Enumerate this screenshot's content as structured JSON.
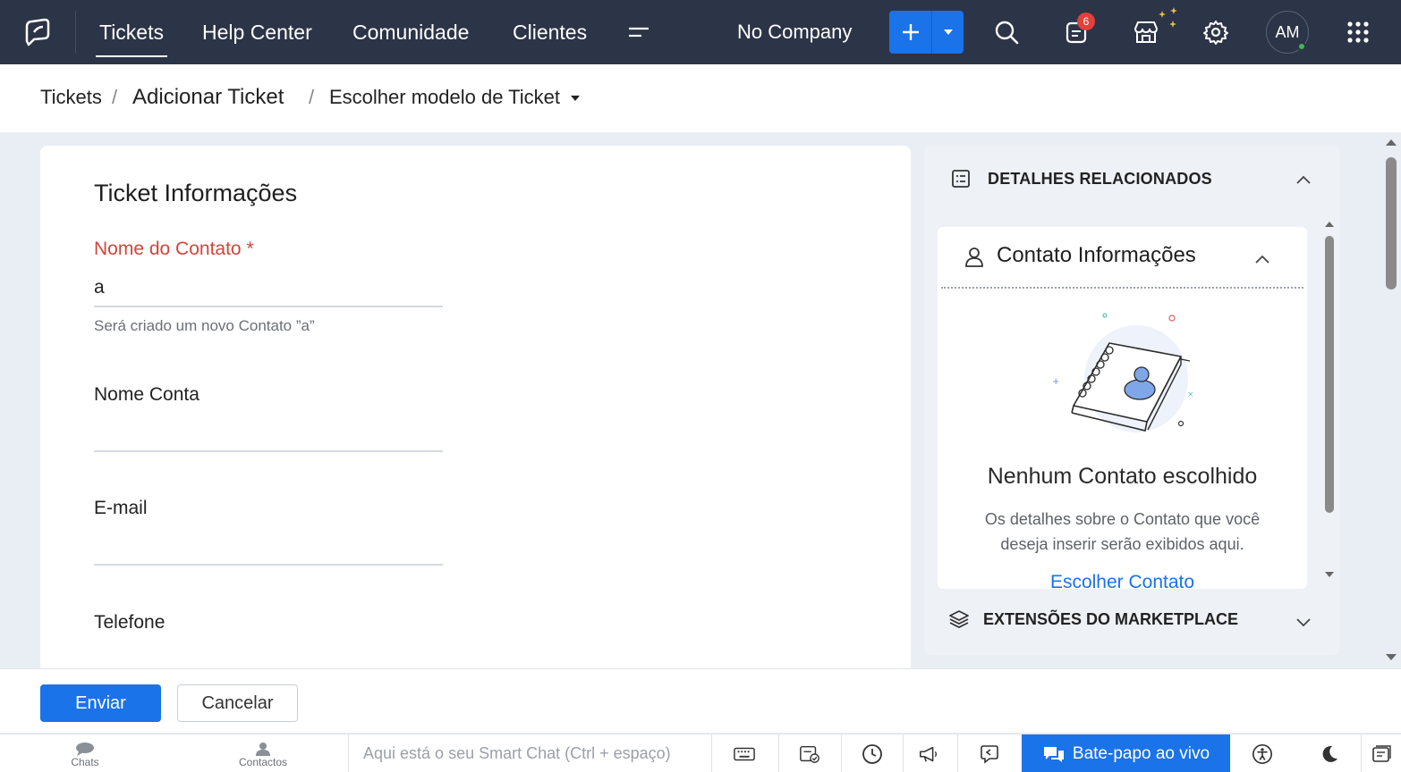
{
  "nav": {
    "items": [
      {
        "label": "Tickets"
      },
      {
        "label": "Help Center"
      },
      {
        "label": "Comunidade"
      },
      {
        "label": "Clientes"
      }
    ],
    "company": "No Company",
    "notification_count": "6",
    "avatar_initials": "AM"
  },
  "breadcrumb": {
    "root": "Tickets",
    "sep": "/",
    "current": "Adicionar Ticket",
    "template": "Escolher modelo de Ticket"
  },
  "form": {
    "title": "Ticket Informações",
    "contact_label": "Nome do Contato",
    "required_mark": "*",
    "contact_value": "a",
    "contact_hint": "Será criado um novo Contato ”a”",
    "account_label": "Nome Conta",
    "email_label": "E-mail",
    "phone_label": "Telefone"
  },
  "related": {
    "title": "DETALHES RELACIONADOS",
    "contact_section_title": "Contato Informações",
    "empty_title": "Nenhum Contato escolhido",
    "empty_desc": "Os detalhes sobre o Contato que você deseja inserir serão exibidos aqui.",
    "choose_link": "Escolher Contato",
    "marketplace_title": "EXTENSÕES DO MARKETPLACE"
  },
  "actions": {
    "submit": "Enviar",
    "cancel": "Cancelar"
  },
  "statusbar": {
    "chats": "Chats",
    "contacts": "Contactos",
    "smartchat_placeholder": "Aqui está o seu Smart Chat (Ctrl + espaço)",
    "livechat": "Bate-papo ao vivo"
  },
  "colors": {
    "nav_bg": "#2c3447",
    "accent": "#1a73e8",
    "required": "#d1453b"
  }
}
